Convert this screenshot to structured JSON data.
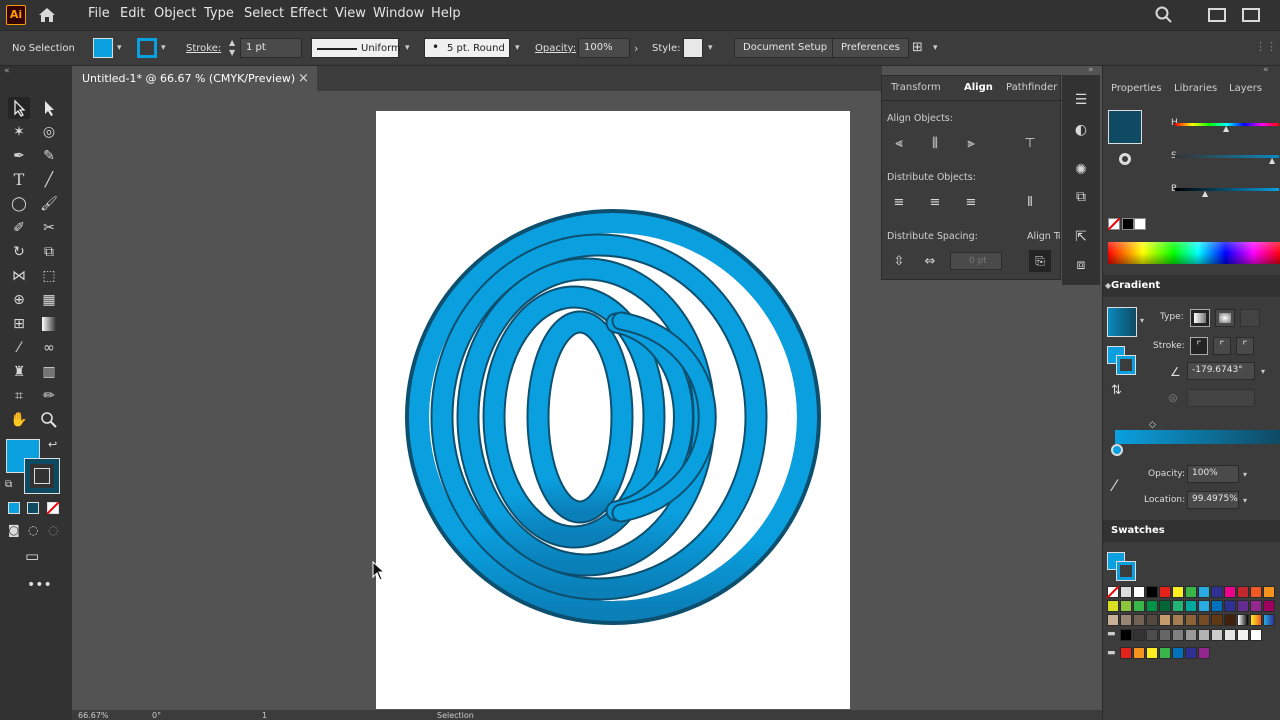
{
  "app": {
    "logo": "Ai"
  },
  "menu": [
    "File",
    "Edit",
    "Object",
    "Type",
    "Select",
    "Effect",
    "View",
    "Window",
    "Help"
  ],
  "control_bar": {
    "selection": "No Selection",
    "stroke_label": "Stroke:",
    "stroke_weight": "1 pt",
    "stroke_profile": "Uniform",
    "brush": "5 pt. Round",
    "opacity_label": "Opacity:",
    "opacity_value": "100%",
    "style_label": "Style:",
    "document_setup": "Document Setup",
    "preferences": "Preferences"
  },
  "document": {
    "tab_title": "Untitled-1* @ 66.67 % (CMYK/Preview)",
    "close": "×"
  },
  "align_panel": {
    "tabs": [
      "Transform",
      "Align",
      "Pathfinder"
    ],
    "align_objects": "Align Objects:",
    "distribute_objects": "Distribute Objects:",
    "distribute_spacing": "Distribute Spacing:",
    "spacing_value": "0 pt",
    "align_to": "Align To:"
  },
  "right_panel": {
    "tabs": [
      "Properties",
      "Libraries",
      "Layers"
    ],
    "color_labels": [
      "H",
      "S",
      "B"
    ],
    "gradient_title": "Gradient",
    "type_label": "Type:",
    "stroke_label": "Stroke:",
    "angle_value": "-179.6743°",
    "opacity_label": "Opacity:",
    "opacity_value": "100%",
    "location_label": "Location:",
    "location_value": "99.4975%",
    "swatches_title": "Swatches"
  },
  "status_bar": {
    "zoom": "66.67%",
    "rotation": "0°",
    "artboard": "1",
    "mode": "Selection"
  },
  "colors": {
    "fill": "#0aa0e0",
    "gradient_dark": "#0f4a63",
    "ring_stroke": "#0d4f6e"
  }
}
